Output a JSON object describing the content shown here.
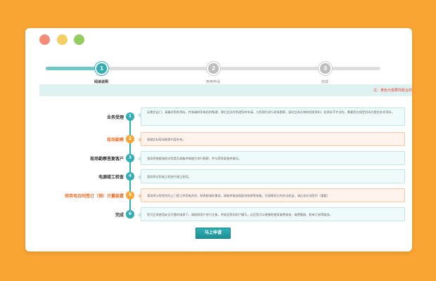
{
  "steps": [
    {
      "number": "1",
      "label": "阅读说明",
      "active": true
    },
    {
      "number": "2",
      "label": "用电申请",
      "active": false
    },
    {
      "number": "3",
      "label": "完成",
      "active": false
    }
  ],
  "progress_fraction": 0.17,
  "notice": "注：黄色为需要你配合的",
  "process": [
    {
      "number": "1",
      "title": "业务受理",
      "highlight": false,
      "text": "无需也出门，请备好相关资料，并准确联系电话的畅通；我们会及时受理您的申请，与您预约进行现场勘察，届时会再次收取相关资料；若资料不齐全的，需要您在规定时间内提交补充资料。"
    },
    {
      "number": "2",
      "title": "现场勘察",
      "highlight": true,
      "text": "根据实际现场勘察内容补充。"
    },
    {
      "number": "3",
      "title": "现场勘察答复客户",
      "highlight": false,
      "text": "我局将根据电网对您是否具备供电能力进行勘察，并与您答复相关情况。"
    },
    {
      "number": "4",
      "title": "电源竣工检查",
      "highlight": false,
      "text": "我局将对您电工程进行竣工检验。"
    },
    {
      "number": "5",
      "title": "供用电合同签订（预）计量装置",
      "highlight": true,
      "text": "我局将与您签约的上门签订供用电合同，装表接电的事宜，请按供电流程配合装接等准备，为保障双方的合法权益，请过去在场签约（重要）"
    },
    {
      "number": "6",
      "title": "完成",
      "highlight": false,
      "text": "您可正常使用安全可靠的电源了，请按照用户进行注册，并绑定您的用户编号，以后您可以便捷地使用电费查询、电费缴纳、账单订阅等服务。"
    }
  ],
  "apply_button": "马上申请",
  "colors": {
    "background": "#f9a534",
    "accent": "#30aeb5",
    "highlight": "#f26b21",
    "notice": "#e8452f"
  }
}
